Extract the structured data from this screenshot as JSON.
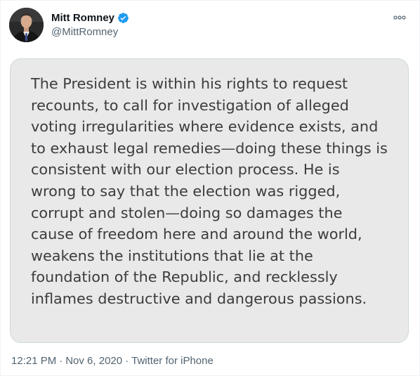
{
  "tweet": {
    "author": {
      "display_name": "Mitt Romney",
      "handle": "@MittRomney",
      "verified": true,
      "verified_color": "#1d9bf0"
    },
    "more_icon": "more-options-icon",
    "media": {
      "lines": [
        "The President is within his rights to request",
        "recounts, to call for investigation of alleged",
        "voting irregularities where evidence exists, and",
        "to exhaust legal remedies—doing these things is",
        "consistent with our election process. He is",
        "wrong to say that the election was rigged,",
        "corrupt and stolen—doing so damages the",
        "cause of freedom here and around the world,",
        "weakens the institutions that lie at the",
        "foundation of the Republic, and recklessly",
        "inflames destructive and dangerous passions."
      ]
    },
    "meta": {
      "time": "12:21 PM",
      "separator": "·",
      "date": "Nov 6, 2020",
      "source": "Twitter for iPhone"
    }
  }
}
